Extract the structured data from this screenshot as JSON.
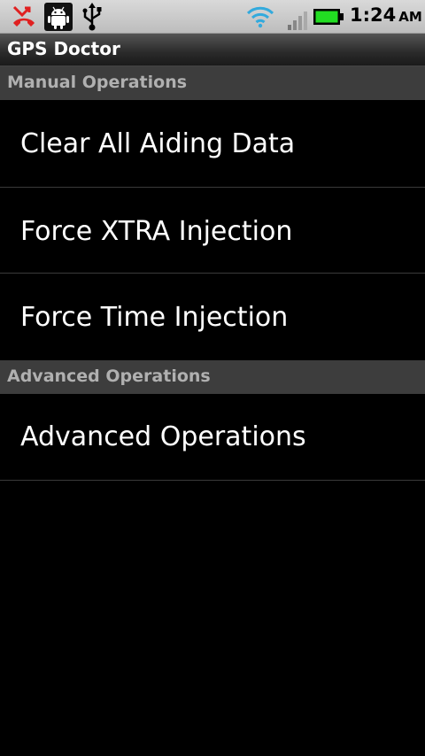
{
  "status_bar": {
    "icons": [
      "missed-call-icon",
      "android-debug-icon",
      "usb-icon",
      "wifi-icon",
      "signal-icon",
      "battery-icon"
    ],
    "time": "1:24",
    "ampm": "AM",
    "battery_color": "#22dd22",
    "wifi_color": "#33aadd",
    "missed_call_color": "#e02020"
  },
  "app": {
    "title": "GPS Doctor"
  },
  "sections": [
    {
      "header": "Manual Operations",
      "items": [
        {
          "label": "Clear All Aiding Data"
        },
        {
          "label": "Force XTRA Injection"
        },
        {
          "label": "Force Time Injection"
        }
      ]
    },
    {
      "header": "Advanced Operations",
      "items": [
        {
          "label": "Advanced Operations"
        }
      ]
    }
  ]
}
